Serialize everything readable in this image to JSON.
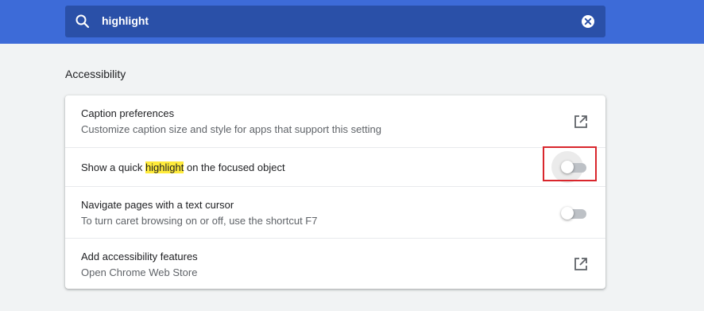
{
  "search": {
    "query": "highlight",
    "search_icon": "search-icon",
    "clear_icon": "close-circle-icon"
  },
  "section": {
    "title": "Accessibility"
  },
  "settings": [
    {
      "title": "Caption preferences",
      "subtitle": "Customize caption size and style for apps that support this setting",
      "control": "external-link-icon"
    },
    {
      "title_before": "Show a quick ",
      "title_highlight": "highlight",
      "title_after": " on the focused object",
      "control": "toggle",
      "checked": false
    },
    {
      "title": "Navigate pages with a text cursor",
      "subtitle": "To turn caret browsing on or off, use the shortcut F7",
      "control": "toggle",
      "checked": false
    },
    {
      "title": "Add accessibility features",
      "subtitle": "Open Chrome Web Store",
      "control": "external-link-icon"
    }
  ],
  "colors": {
    "header_blue": "#3d6bd8",
    "search_box": "#2a50a8",
    "highlight": "#ffeb3b",
    "annotation_red": "#d9262c"
  }
}
